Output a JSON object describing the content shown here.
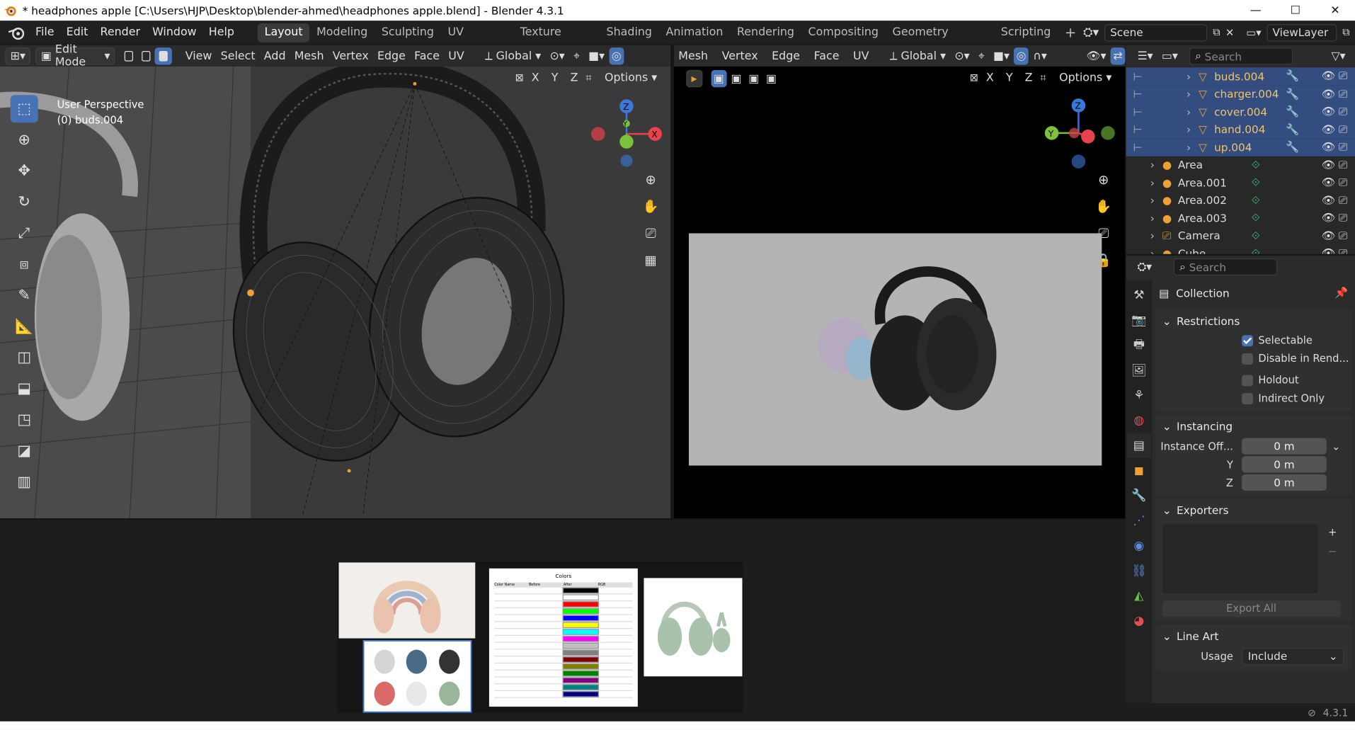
{
  "window": {
    "title": "* headphones apple [C:\\Users\\HJP\\Desktop\\blender-ahmed\\headphones apple.blend] - Blender 4.3.1",
    "minimize": "—",
    "maximize": "☐",
    "close": "✕"
  },
  "menubar": {
    "items": [
      "File",
      "Edit",
      "Render",
      "Window",
      "Help"
    ]
  },
  "workspaces": [
    "Layout",
    "Modeling",
    "Sculpting",
    "UV Editing",
    "Texture Paint",
    "Shading",
    "Animation",
    "Rendering",
    "Compositing",
    "Geometry Nodes",
    "Scripting"
  ],
  "workspace_add": "+",
  "scene": {
    "name": "Scene"
  },
  "viewlayer": {
    "name": "ViewLayer"
  },
  "viewport_left": {
    "mode": "Edit Mode",
    "menus": [
      "View",
      "Select",
      "Add",
      "Mesh",
      "Vertex",
      "Edge",
      "Face",
      "UV"
    ],
    "transform_orientation": "Global",
    "axes": [
      "X",
      "Y",
      "Z"
    ],
    "options": "Options",
    "overlay_text_line1": "User Perspective",
    "overlay_text_line2": "(0) buds.004",
    "gizmo": {
      "x": "X",
      "y": "Y",
      "z": "Z"
    }
  },
  "viewport_right": {
    "menus": [
      "Mesh",
      "Vertex",
      "Edge",
      "Face",
      "UV"
    ],
    "transform_orientation": "Global",
    "axes": [
      "X",
      "Y",
      "Z"
    ],
    "options": "Options",
    "gizmo": {
      "x": "X",
      "y": "Y",
      "z": "Z"
    }
  },
  "outliner": {
    "search_placeholder": "Search",
    "rows": [
      {
        "name": "buds.004",
        "selected": true,
        "color": "#f0c46a"
      },
      {
        "name": "charger.004",
        "selected": true,
        "color": "#f0c46a"
      },
      {
        "name": "cover.004",
        "selected": true,
        "color": "#f0c46a"
      },
      {
        "name": "hand.004",
        "selected": true,
        "color": "#f0c46a"
      },
      {
        "name": "up.004",
        "selected": true,
        "color": "#f0c46a"
      },
      {
        "name": "Area",
        "selected": false,
        "color": "#dcdcdc"
      },
      {
        "name": "Area.001",
        "selected": false,
        "color": "#dcdcdc"
      },
      {
        "name": "Area.002",
        "selected": false,
        "color": "#dcdcdc"
      },
      {
        "name": "Area.003",
        "selected": false,
        "color": "#dcdcdc"
      },
      {
        "name": "Camera",
        "selected": false,
        "color": "#dcdcdc"
      },
      {
        "name": "Cube",
        "selected": false,
        "color": "#dcdcdc"
      }
    ]
  },
  "properties": {
    "search_placeholder": "Search",
    "context": "Collection",
    "restrictions": {
      "header": "Restrictions",
      "selectable": "Selectable",
      "disable_in_renders": "Disable in Rend...",
      "holdout": "Holdout",
      "indirect_only": "Indirect Only",
      "selectable_checked": true
    },
    "instancing": {
      "header": "Instancing",
      "offset_label": "Instance Off...",
      "x_value": "0 m",
      "y_label": "Y",
      "y_value": "0 m",
      "z_label": "Z",
      "z_value": "0 m"
    },
    "exporters": {
      "header": "Exporters",
      "export_all": "Export All",
      "plus": "+",
      "minus": "−"
    },
    "line_art": {
      "header": "Line Art",
      "usage_label": "Usage",
      "usage_value": "Include"
    }
  },
  "statusbar": {
    "version": "4.3.1"
  },
  "colors": {
    "accent": "#4772b3",
    "selected_row": "#334d80",
    "gizmo_x": "#e8424a",
    "gizmo_y": "#7bc13a",
    "gizmo_z": "#3c78d8",
    "object_orange": "#f0a030"
  },
  "reference_images": {
    "color_table_title": "Colors",
    "color_table_headers": [
      "Color Name",
      "Before",
      "After",
      "RGB"
    ]
  }
}
